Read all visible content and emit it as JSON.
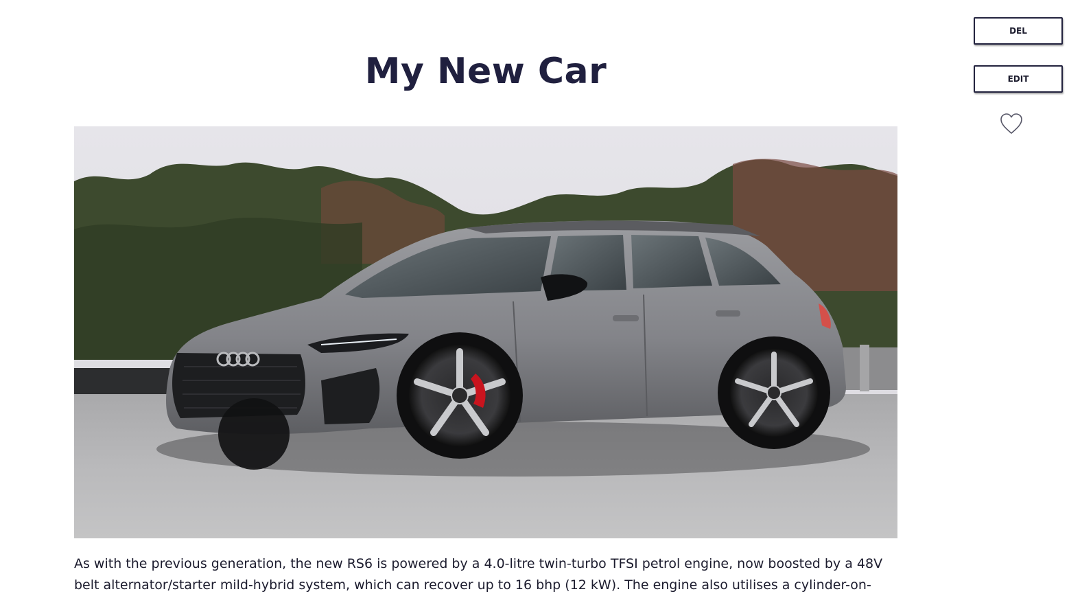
{
  "post": {
    "title": "My New Car",
    "body": "As with the previous generation, the new RS6 is powered by a 4.0-litre twin-turbo TFSI petrol engine, now boosted by a 48V belt alternator/starter mild-hybrid system, which can recover up to 16 bhp (12 kW). The engine also utilises a cylinder-on-"
  },
  "actions": {
    "delete_label": "DEL",
    "edit_label": "EDIT",
    "like_icon": "heart-outline-icon"
  },
  "image": {
    "subject": "car-photo",
    "car_color": "#8a8b8e",
    "caliper_color": "#c8141e"
  }
}
